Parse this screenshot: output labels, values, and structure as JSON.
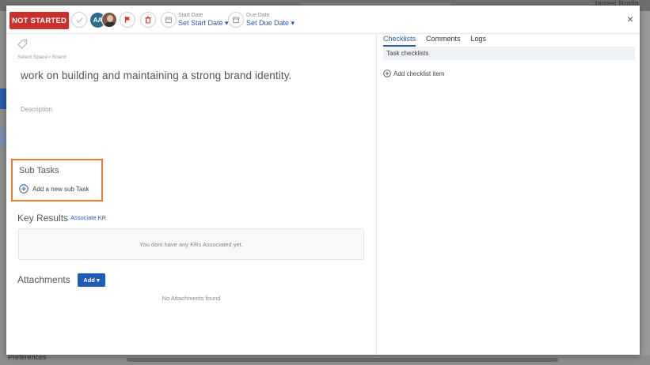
{
  "background": {
    "user_name": "James Bralia",
    "bottom_label": "Preferences"
  },
  "header": {
    "status_label": "NOT STARTED",
    "assignee_initials": "AA",
    "start_date_caption": "Start Date",
    "start_date_value": "Set Start Date ▾",
    "due_date_caption": "Due Date",
    "due_date_value": "Set Due Date ▾",
    "close_label": "×"
  },
  "task": {
    "breadcrumb": "Select Space> Board",
    "title": "work on building and maintaining a strong brand identity.",
    "description_placeholder": "Description"
  },
  "subtasks": {
    "title": "Sub Tasks",
    "add_label": "Add a new sub Task"
  },
  "key_results": {
    "title": "Key Results",
    "associate_link": "Associate KR",
    "empty_text": "You dont have any KRs Associated yet."
  },
  "attachments": {
    "title": "Attachments",
    "add_button": "Add ▾",
    "empty_text": "No Attachments found"
  },
  "right_panel": {
    "tabs": [
      {
        "label": "Checklists",
        "active": true
      },
      {
        "label": "Comments",
        "active": false
      },
      {
        "label": "Logs",
        "active": false
      }
    ],
    "checklist_header": "Task checklists",
    "add_checklist_label": "Add checklist item"
  },
  "icons": {
    "check": "check-icon",
    "flag": "flag-icon",
    "trash": "trash-icon",
    "calendar": "calendar-icon",
    "tag": "tag-icon",
    "plus": "plus-circle-icon"
  },
  "colors": {
    "status_red": "#c9302c",
    "accent_blue": "#2b5aa6",
    "highlight_orange": "#ef7a2a",
    "button_blue": "#1f5bb8"
  }
}
